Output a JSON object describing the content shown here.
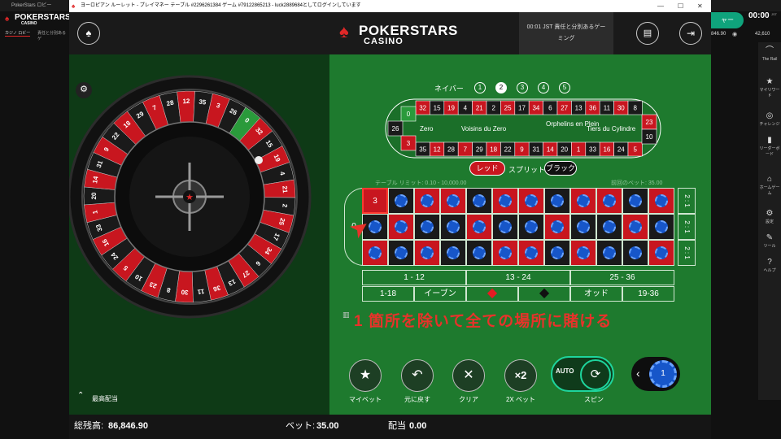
{
  "lobby": {
    "title": "PokerStars ロビー",
    "brand": "POKERSTARS",
    "brand_sub": "CASINO",
    "tab1": "カジノ ロビー",
    "tab2": "責任と分別あるゲ",
    "time": "00:00",
    "time_sub": "JST",
    "balance_small": "846.90",
    "right_value": "42,610",
    "right_btn": "ャー"
  },
  "rail": [
    "The Rail",
    "マイリワード",
    "チャレンジ",
    "リーダーボード",
    "ホームゲーム",
    "設定",
    "ツール",
    "ヘルプ"
  ],
  "window": {
    "title": "ヨーロピアン ルーレット - プレイマネー テーブル #2296261384 ゲーム #79122865213 - luck2889684としてログインしています"
  },
  "header": {
    "logo": "POKERSTARS",
    "logo_sub": "CASINO",
    "info_line1": "00:01 JST 責任と分別あるゲー",
    "info_line2": "ミング"
  },
  "racetrack": {
    "neighbors_label": "ネイバー",
    "neighbors": [
      "1",
      "2",
      "3",
      "4",
      "5"
    ],
    "top": [
      "32",
      "15",
      "19",
      "4",
      "21",
      "2",
      "25",
      "17",
      "34",
      "6",
      "27",
      "13",
      "36",
      "11",
      "30",
      "8"
    ],
    "bottom": [
      "35",
      "12",
      "28",
      "7",
      "29",
      "18",
      "22",
      "9",
      "31",
      "14",
      "20",
      "1",
      "33",
      "16",
      "24",
      "5"
    ],
    "left": [
      "0",
      "26",
      "3"
    ],
    "right": [
      "23",
      "10"
    ],
    "sections": [
      "Zero",
      "Voisins du Zero",
      "Orphelins en Plein",
      "Tiers du Cylindre"
    ],
    "red_btn": "レッド",
    "split": "スプリット",
    "black_btn": "ブラック"
  },
  "table": {
    "limit": "テーブル リミット: 0.10 - 10,000.00",
    "last_bet": "前回のベット: 35.00",
    "zero": "0",
    "selected": "3",
    "dozens": [
      "1 - 12",
      "13 - 24",
      "25 - 36"
    ],
    "outside": [
      "1-18",
      "イーブン",
      "",
      "",
      "オッド",
      "19-36"
    ],
    "columns": [
      "2 : 1",
      "2 : 1",
      "2 : 1"
    ]
  },
  "caption": "1 箇所を除いて全ての場所に賭ける",
  "controls": {
    "my_bet": "マイベット",
    "undo": "元に戻す",
    "clear": "クリア",
    "double": "2X ベット",
    "spin": "スピン",
    "auto": "AUTO",
    "x2": "×2",
    "chip": "1",
    "max": "最高配当"
  },
  "footer": {
    "balance_label": "総残高:",
    "balance": "86,846.90",
    "bet_label": "ベット:",
    "bet": "35.00",
    "payout_label": "配当",
    "payout": "0.00"
  },
  "wheel_numbers": [
    "0",
    "32",
    "15",
    "19",
    "4",
    "21",
    "2",
    "25",
    "17",
    "34",
    "6",
    "27",
    "13",
    "36",
    "11",
    "30",
    "8",
    "23",
    "10",
    "5",
    "24",
    "16",
    "33",
    "1",
    "20",
    "14",
    "31",
    "9",
    "22",
    "18",
    "29",
    "7",
    "28",
    "12",
    "35",
    "3",
    "26"
  ],
  "colors": {
    "felt": "#1e7a2e",
    "red": "#c8161f",
    "black": "#1a1a1a",
    "caption": "#e8322a"
  }
}
